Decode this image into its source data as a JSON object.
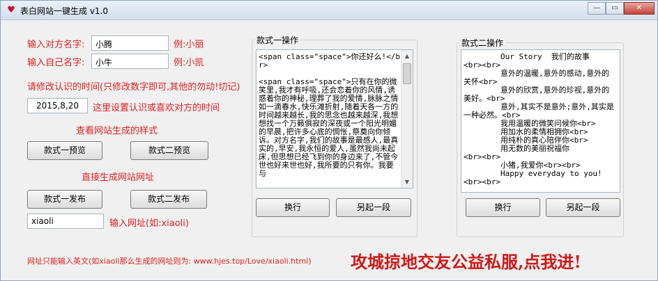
{
  "window": {
    "title": "表白网站一键生成 v1.0",
    "app_icon": "heart-icon"
  },
  "form": {
    "partner_name_label": "输入对方名字:",
    "partner_name_value": "小腾",
    "partner_name_example": "例:小丽",
    "own_name_label": "输入自己名字:",
    "own_name_value": "小牛",
    "own_name_example": "例:小凯",
    "date_note": "请修改认识的时间(只修改数字即可,其他的勿动!切记)",
    "date_value": "2015,8,20",
    "date_hint": "这里设置认识或喜欢对方的时间",
    "preview_section": "查看网站生成的样式",
    "preview1_button": "款式一预览",
    "preview2_button": "款式二预览",
    "publish_section": "直接生成网站网址",
    "publish1_button": "款式一发布",
    "publish2_button": "款式二发布",
    "url_value": "xiaoli",
    "url_label": "输入网址(如:xiaoli)",
    "footer_note": "网址只能输入英文(如xiaoli那么生成的网址则为: www.hjes.top/Love/xiaoli.html)",
    "promo": "攻城掠地交友公益私服,点我进!"
  },
  "style1": {
    "title": "款式一操作",
    "content": "<span class=\"space\">你还好么!</br>\n\n<span class=\"space\">只有在你的微笑里,我才有呼吸,还会恋着你的风情,诱惑着你的神秘,理葬了我的爱情,脉脉之情如一滴春水,快乐滩折射,随着天各一方的时间越来越长,我的思念也越来越深,我想想找一个万籁俱寂的深夜或一个阳光明媚的早晨,把许多心底的惆怅,祭奠向你倾诉。对方名字,我们的故事是最感人,最真实的,早安,我永恒的爱人,虽然我尚未起床,但思想已经飞到你的身边来了,不管今世也好来世也好,我所要的只有你。我要与",
    "newline_button": "换行",
    "newpara_button": "另起一段"
  },
  "style2": {
    "title": "款式二操作",
    "content": "        Our Story  我们的故事\n<br><br>\n        意外的温暖,意外的感动,意外的关怀<br>\n        意外的欣赏,意外的珍视,意外的美好。<br>\n        意外,其实不是意外;意外,其实是一种必然。<br>\n        我用温暖的微笑问候你<br>\n        用加水的柔情相拥你<br>\n        用纯朴的真心陪伴你<br>\n        用无数的美丽祝福你\n<br><br>\n        小猪,我爱你<br><br>\n        Happy everyday to you!\n<br><br>",
    "newline_button": "换行",
    "newpara_button": "另起一段"
  }
}
